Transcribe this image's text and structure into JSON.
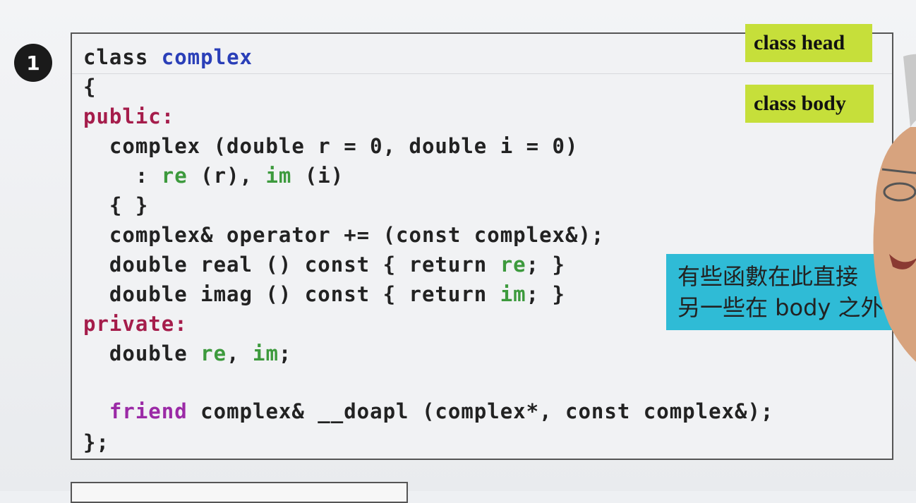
{
  "slide": {
    "step_number": "1",
    "tags": {
      "class_head": "class head",
      "class_body": "class body"
    },
    "note": {
      "line1": "有些函數在此直接",
      "line2": "另一些在 body 之外"
    },
    "code": {
      "l1_a": "class ",
      "l1_b": "complex",
      "l2": "{",
      "l3": "public:",
      "l4": "  complex (double r = 0, double i = 0)",
      "l5_a": "    : ",
      "l5_b": "re",
      "l5_c": " (r), ",
      "l5_d": "im",
      "l5_e": " (i)",
      "l6": "  { }",
      "l7": "  complex& operator += (const complex&);",
      "l8_a": "  double real () const { return ",
      "l8_b": "re",
      "l8_c": "; }",
      "l9_a": "  double imag () const { return ",
      "l9_b": "im",
      "l9_c": "; }",
      "l10": "private:",
      "l11_a": "  double ",
      "l11_b": "re",
      "l11_c": ", ",
      "l11_d": "im",
      "l11_e": ";",
      "l12_a": "  ",
      "l12_b": "friend",
      "l12_c": " complex& __doapl (complex*, const complex&);",
      "l13": "};"
    },
    "colors": {
      "class_name": "#2a3fb8",
      "access": "#a51d4b",
      "member": "#3d9a3d",
      "friend": "#9b2aa6",
      "tag_bg": "#c6df3a",
      "note_bg": "#2fbbd6"
    }
  }
}
